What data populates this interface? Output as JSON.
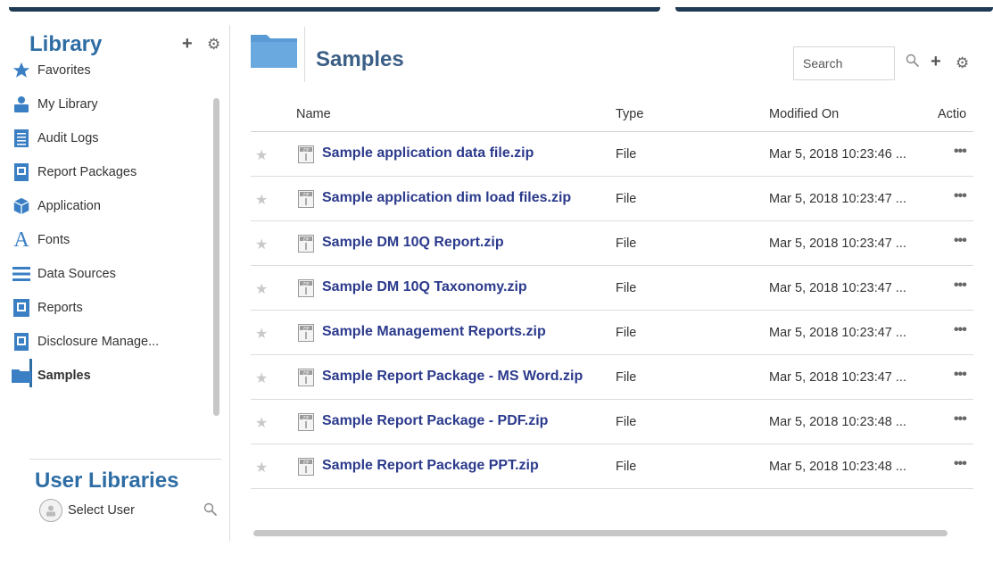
{
  "sidebar": {
    "title": "Library",
    "add_icon": "plus-icon",
    "settings_icon": "gear-icon",
    "items": [
      {
        "label": "Favorites",
        "icon": "star-icon"
      },
      {
        "label": "My Library",
        "icon": "user-icon"
      },
      {
        "label": "Audit Logs",
        "icon": "document-icon"
      },
      {
        "label": "Report Packages",
        "icon": "report-package-icon"
      },
      {
        "label": "Application",
        "icon": "cube-icon"
      },
      {
        "label": "Fonts",
        "icon": "font-icon"
      },
      {
        "label": "Data Sources",
        "icon": "list-icon"
      },
      {
        "label": "Reports",
        "icon": "report-icon"
      },
      {
        "label": "Disclosure Manage...",
        "icon": "disclosure-icon"
      },
      {
        "label": "Samples",
        "icon": "folder-icon",
        "active": true
      }
    ],
    "user_libraries": {
      "title": "User Libraries",
      "select_user_label": "Select User",
      "search_icon": "search-icon"
    }
  },
  "main": {
    "title": "Samples",
    "search": {
      "placeholder": "Search"
    },
    "table": {
      "columns": [
        "Name",
        "Type",
        "Modified On",
        "Actio"
      ],
      "rows": [
        {
          "name": "Sample application data file.zip",
          "type": "File",
          "modified": "Mar 5, 2018 10:23:46 ...",
          "actions": "•••"
        },
        {
          "name": "Sample application dim load files.zip",
          "type": "File",
          "modified": "Mar 5, 2018 10:23:47 ...",
          "actions": "•••"
        },
        {
          "name": "Sample DM 10Q Report.zip",
          "type": "File",
          "modified": "Mar 5, 2018 10:23:47 ...",
          "actions": "•••"
        },
        {
          "name": "Sample DM 10Q Taxonomy.zip",
          "type": "File",
          "modified": "Mar 5, 2018 10:23:47 ...",
          "actions": "•••"
        },
        {
          "name": "Sample Management Reports.zip",
          "type": "File",
          "modified": "Mar 5, 2018 10:23:47 ...",
          "actions": "•••"
        },
        {
          "name": "Sample Report Package - MS Word.zip",
          "type": "File",
          "modified": "Mar 5, 2018 10:23:47 ...",
          "actions": "•••"
        },
        {
          "name": "Sample Report Package - PDF.zip",
          "type": "File",
          "modified": "Mar 5, 2018 10:23:48 ...",
          "actions": "•••"
        },
        {
          "name": "Sample Report Package PPT.zip",
          "type": "File",
          "modified": "Mar 5, 2018 10:23:48 ...",
          "actions": "•••"
        }
      ]
    }
  },
  "colors": {
    "accent": "#2e6da4",
    "title": "#3b5f86",
    "link": "#2b3a8c",
    "topbar": "#1f3a55",
    "folder": "#5b9bd5"
  }
}
